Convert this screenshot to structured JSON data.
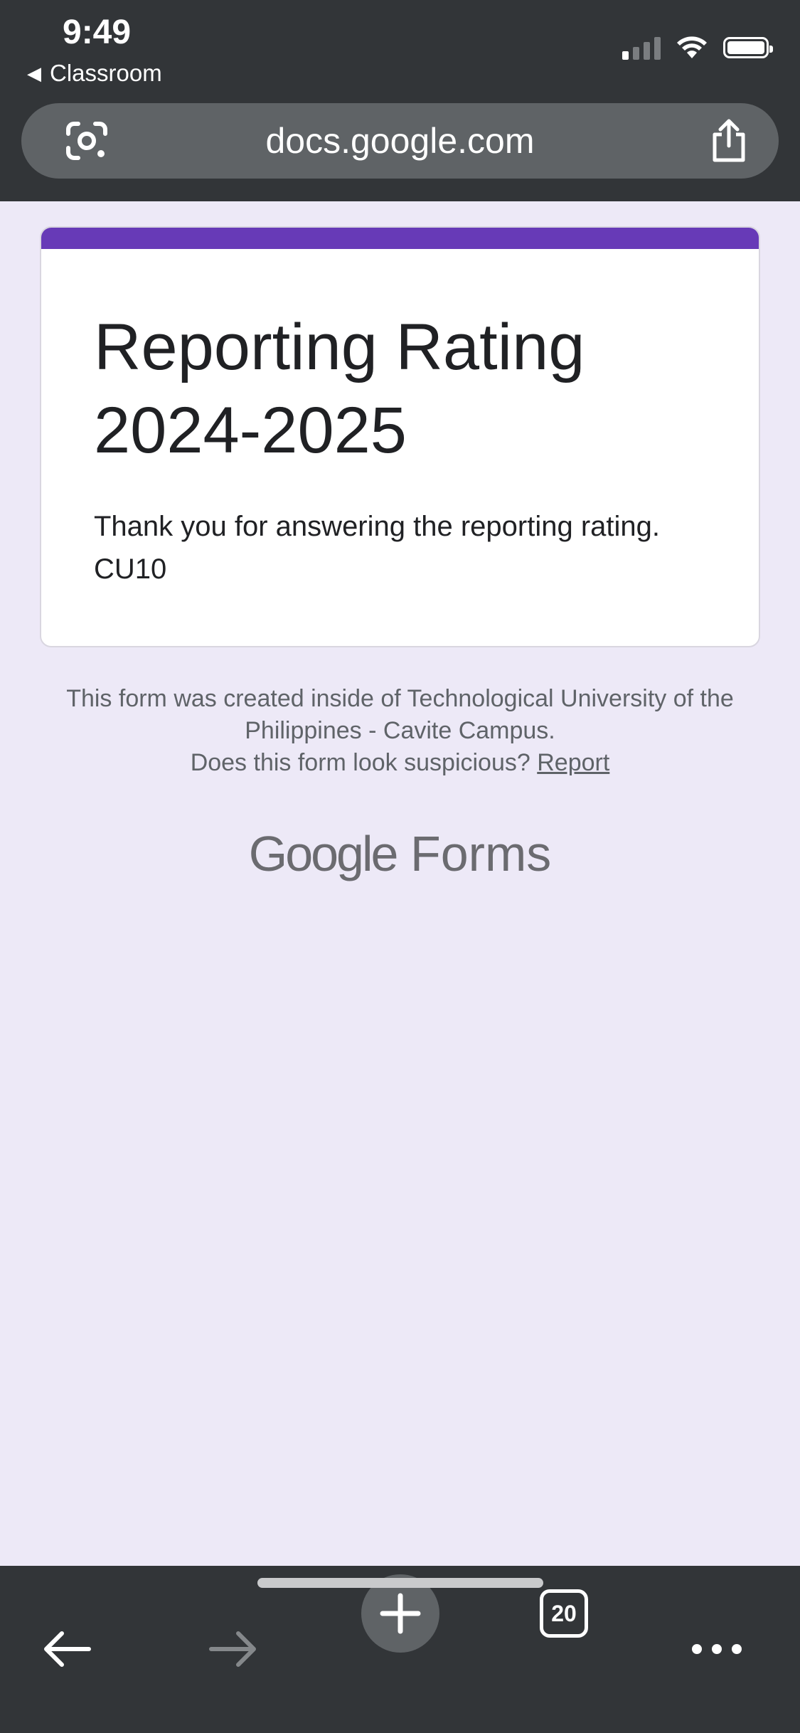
{
  "status_bar": {
    "time": "9:49",
    "back_app": "Classroom"
  },
  "browser": {
    "url": "docs.google.com",
    "tab_count": "20"
  },
  "form": {
    "accent_color": "#673ab7",
    "title": "Reporting Rating 2024-2025",
    "description": "Thank you for answering the reporting rating. CU10"
  },
  "footer": {
    "created_line": "This form was created inside of Technological University of the Philippines - Cavite Campus.",
    "suspicious_question": "Does this form look suspicious?",
    "report_link": "Report"
  },
  "branding": {
    "google": "Google",
    "forms": "Forms"
  },
  "icons": {
    "lens": "google-lens-icon",
    "share": "share-icon",
    "back": "back-arrow-icon",
    "forward": "forward-arrow-icon",
    "new_tab": "plus-icon",
    "tabs": "tab-switcher-icon",
    "more": "more-icon"
  }
}
